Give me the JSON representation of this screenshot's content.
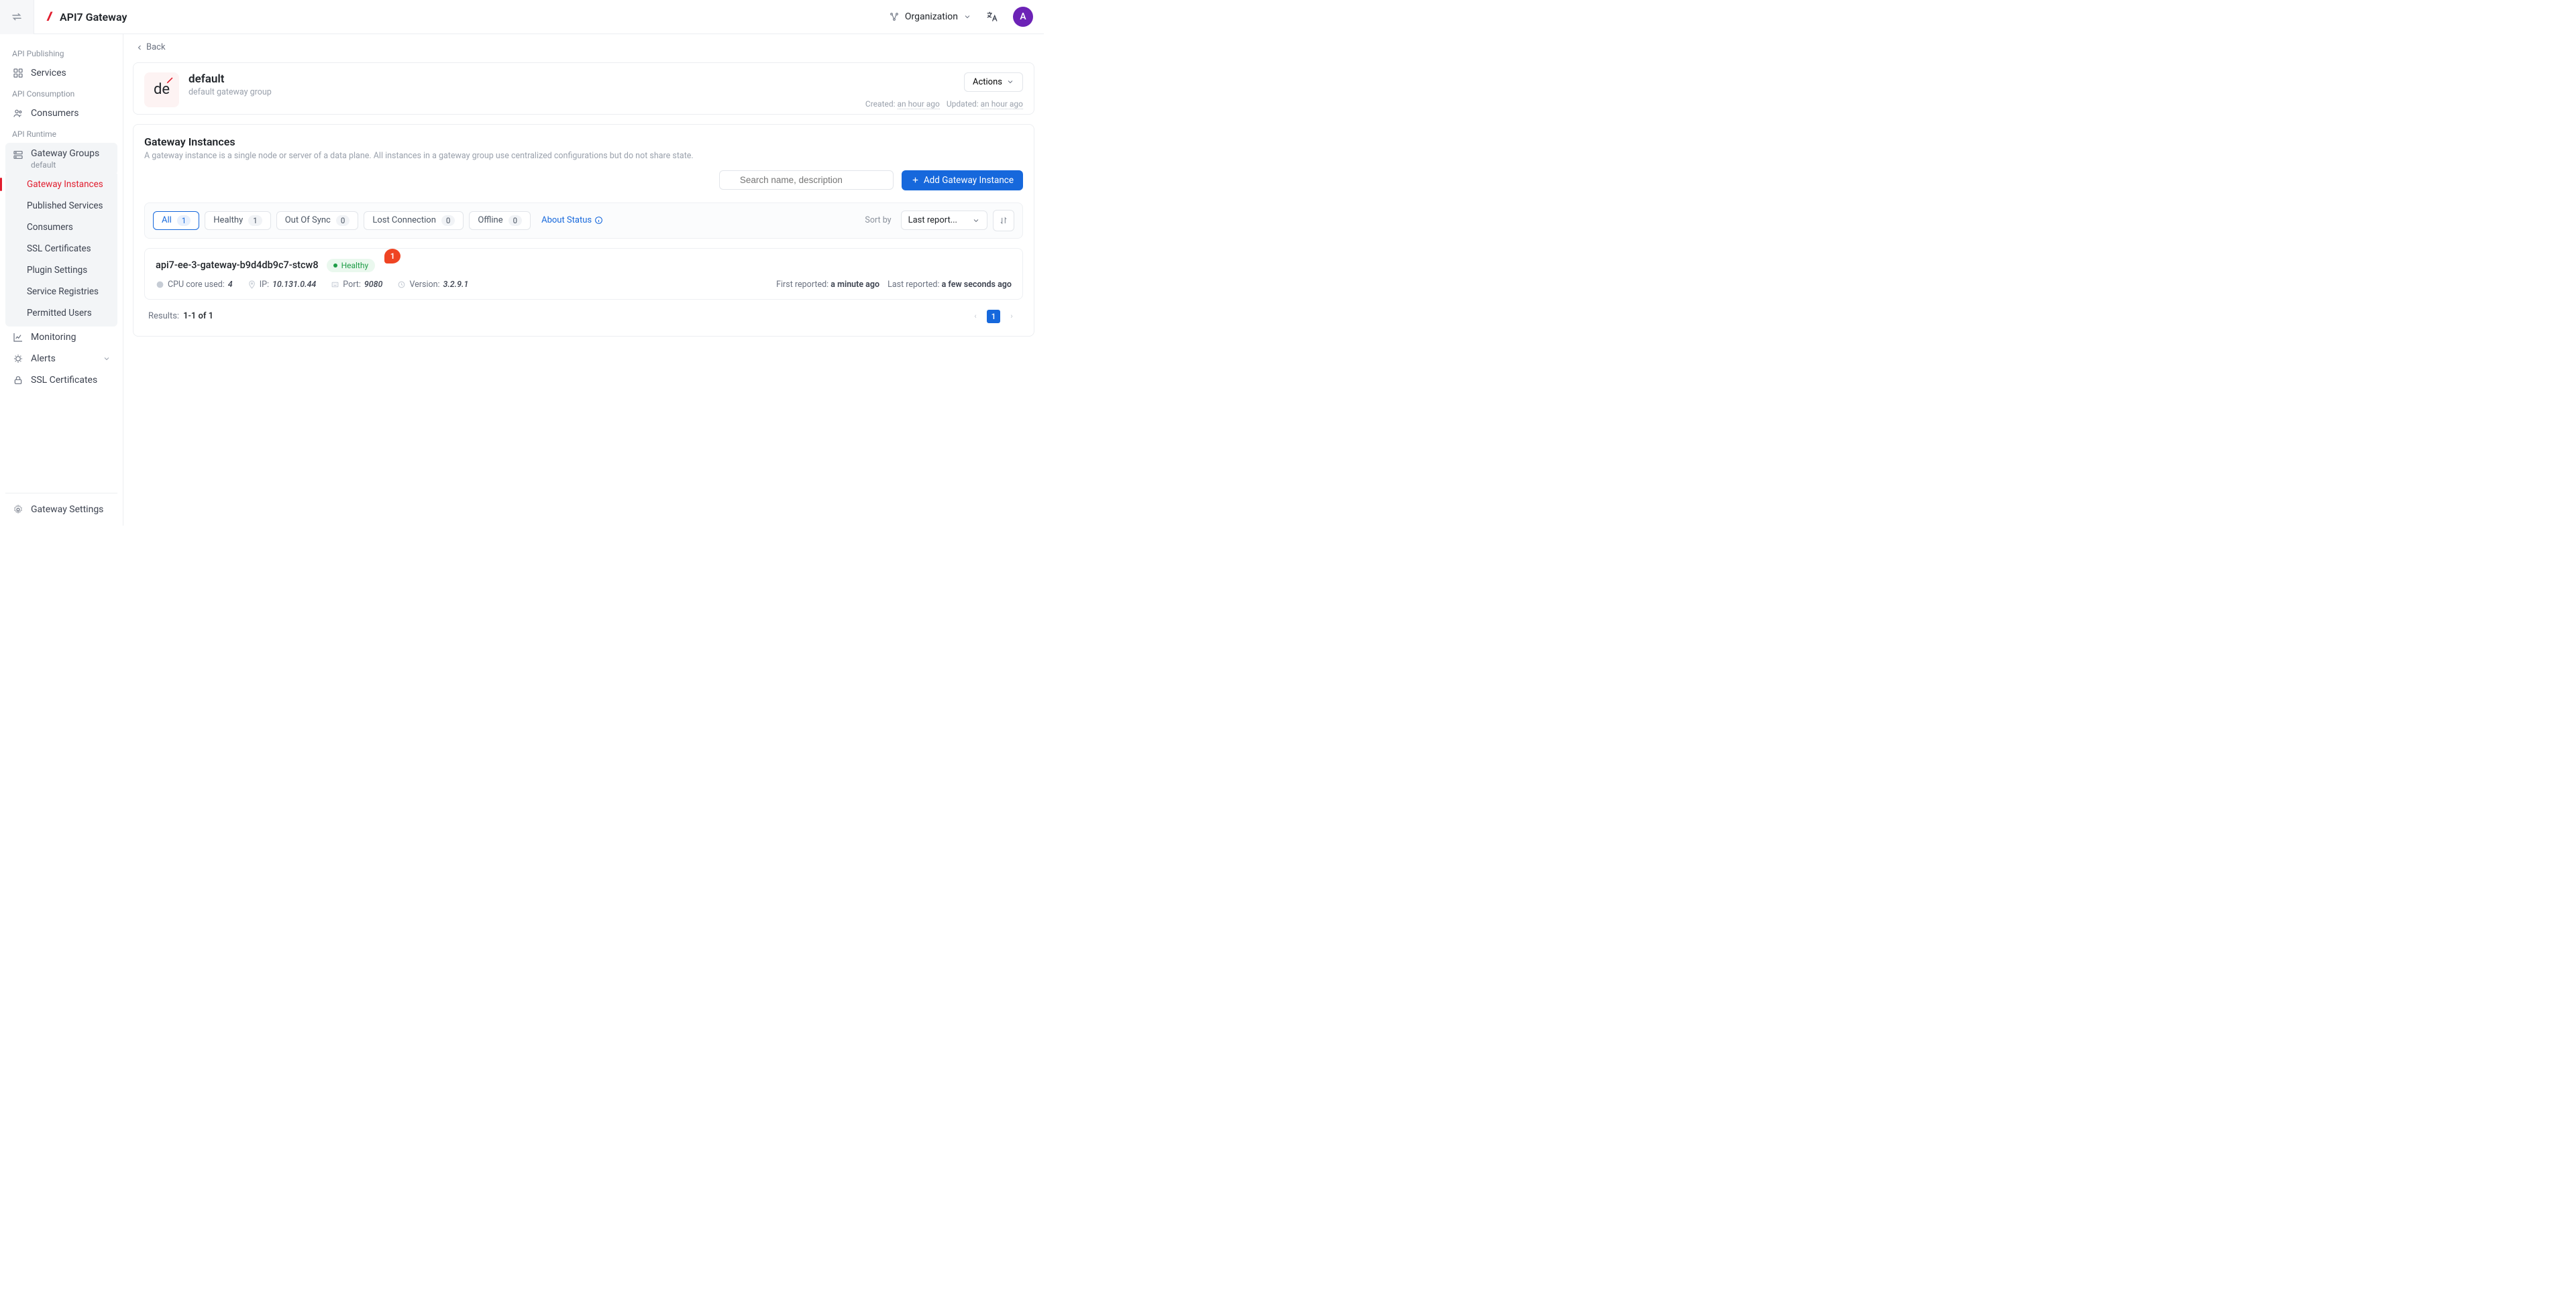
{
  "brand": {
    "name": "API7 Gateway"
  },
  "header": {
    "organization_label": "Organization",
    "avatar_initial": "A"
  },
  "sidebar": {
    "sections": {
      "publishing": "API Publishing",
      "consumption": "API Consumption",
      "runtime": "API Runtime"
    },
    "items": {
      "services": "Services",
      "consumers": "Consumers",
      "gateway_groups": "Gateway Groups",
      "gateway_groups_sub": "default",
      "gateway_instances": "Gateway Instances",
      "published_services": "Published Services",
      "sub_consumers": "Consumers",
      "ssl_certificates_sub": "SSL Certificates",
      "plugin_settings": "Plugin Settings",
      "service_registries": "Service Registries",
      "permitted_users": "Permitted Users",
      "monitoring": "Monitoring",
      "alerts": "Alerts",
      "ssl_certificates": "SSL Certificates",
      "gateway_settings": "Gateway Settings"
    }
  },
  "breadcrumb": {
    "back": "Back"
  },
  "group": {
    "avatar_text": "de",
    "title": "default",
    "subtitle": "default gateway group",
    "actions_label": "Actions",
    "created_label": "Created:",
    "created_value": "an hour ago",
    "updated_label": "Updated:",
    "updated_value": "an hour ago"
  },
  "instances": {
    "title": "Gateway Instances",
    "description": "A gateway instance is a single node or server of a data plane. All instances in a gateway group use centralized configurations but do not share state.",
    "search_placeholder": "Search name, description",
    "add_button": "Add Gateway Instance",
    "tabs": {
      "all": {
        "label": "All",
        "count": "1"
      },
      "healthy": {
        "label": "Healthy",
        "count": "1"
      },
      "out_of_sync": {
        "label": "Out Of Sync",
        "count": "0"
      },
      "lost_connection": {
        "label": "Lost Connection",
        "count": "0"
      },
      "offline": {
        "label": "Offline",
        "count": "0"
      }
    },
    "about_status": "About Status",
    "sort_by_label": "Sort by",
    "sort_value": "Last report...",
    "annotation": "1",
    "item": {
      "name": "api7-ee-3-gateway-b9d4db9c7-stcw8",
      "status": "Healthy",
      "cpu_label": "CPU core used:",
      "cpu_value": "4",
      "ip_label": "IP:",
      "ip_value": "10.131.0.44",
      "port_label": "Port:",
      "port_value": "9080",
      "version_label": "Version:",
      "version_value": "3.2.9.1",
      "first_reported_label": "First reported:",
      "first_reported_value": "a minute ago",
      "last_reported_label": "Last reported:",
      "last_reported_value": "a few seconds ago"
    },
    "results_label": "Results:",
    "results_value": "1-1 of 1",
    "page_current": "1"
  }
}
